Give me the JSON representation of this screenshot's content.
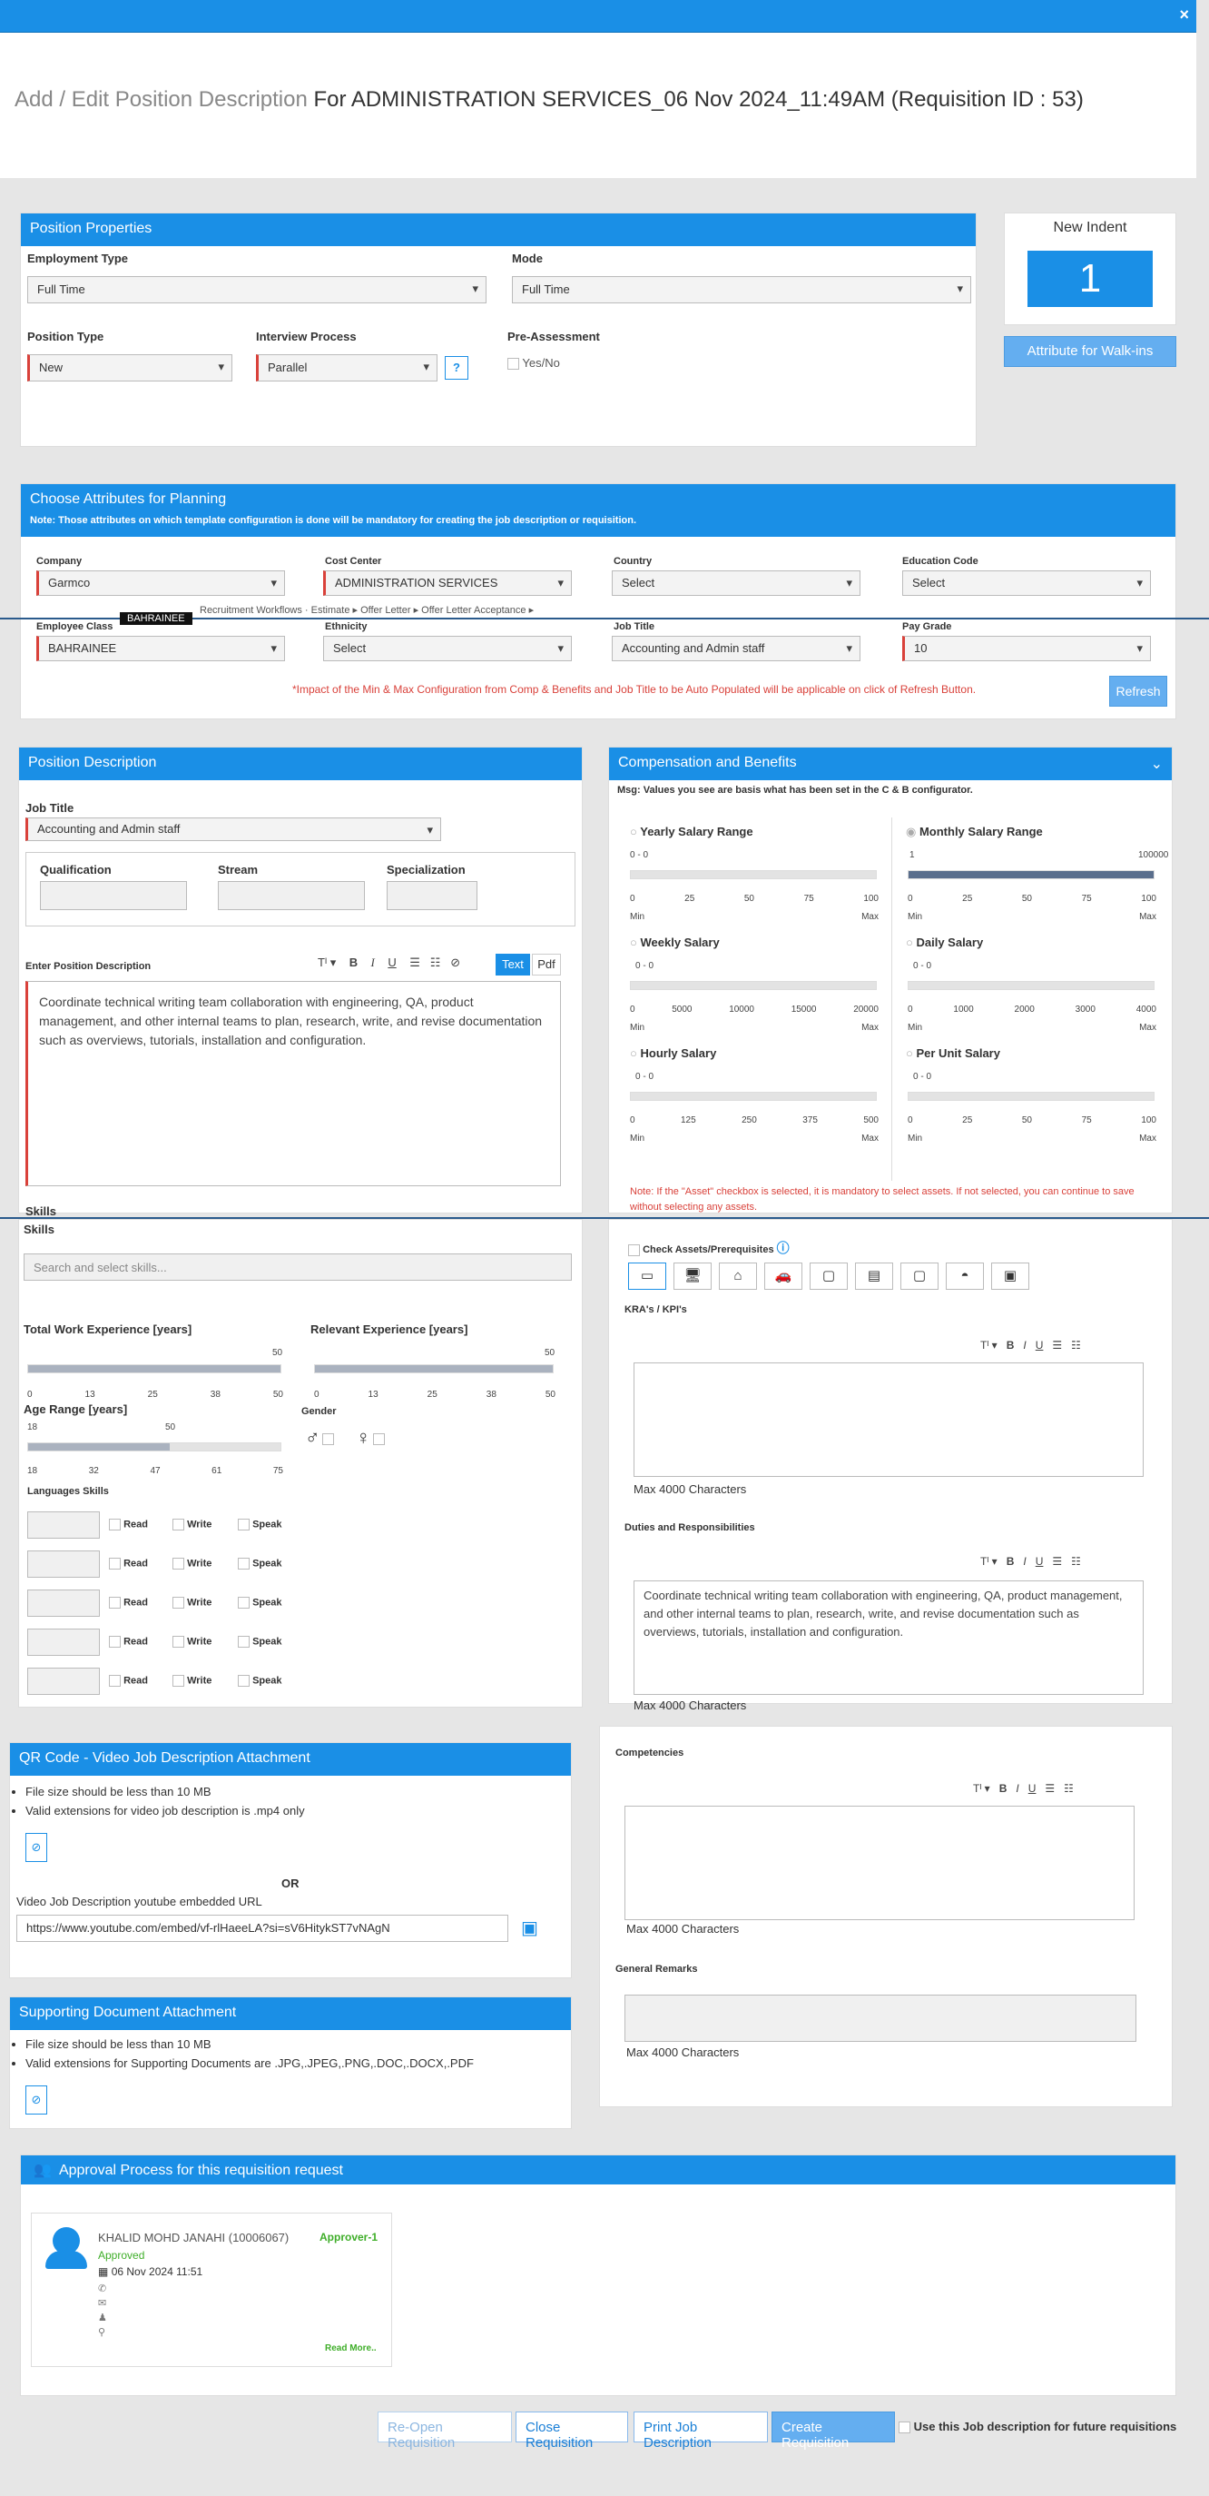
{
  "header": {
    "pre": "Add / Edit Position Description",
    "main": "For ADMINISTRATION SERVICES_06 Nov 2024_11:49AM  (Requisition ID : 53)",
    "close": "×"
  },
  "props": {
    "title": "Position Properties",
    "employment_type_label": "Employment Type",
    "employment_type": "Full Time",
    "mode_label": "Mode",
    "mode": "Full Time",
    "position_type_label": "Position Type",
    "position_type": "New",
    "interview_label": "Interview Process",
    "interview": "Parallel",
    "help": "?",
    "pre_assessment_label": "Pre-Assessment",
    "yes_no": "Yes/No"
  },
  "indent": {
    "title": "New Indent",
    "count": "1",
    "walkins": "Attribute for Walk-ins"
  },
  "attrs": {
    "title": "Choose Attributes for Planning",
    "note": "Note: Those attributes on which template configuration is done will be mandatory for creating the job description or requisition.",
    "company_label": "Company",
    "company": "Garmco",
    "cost_center_label": "Cost Center",
    "cost_center": "ADMINISTRATION SERVICES",
    "country_label": "Country",
    "country": "Select",
    "education_label": "Education Code",
    "education": "Select",
    "employee_class_label": "Employee Class",
    "employee_class": "BAHRAINEE",
    "tooltip": "BAHRAINEE",
    "ethnicity_label": "Ethnicity",
    "ethnicity": "Select",
    "job_title_label": "Job Title",
    "job_title": "Accounting and Admin staff",
    "pay_grade_label": "Pay Grade",
    "pay_grade": "10",
    "impact": "*Impact of the Min & Max Configuration from Comp & Benefits and Job Title to be Auto Populated will be applicable on click of Refresh Button.",
    "refresh": "Refresh",
    "hidden_row": "Recruitment Workflows   ·   Estimate ▸ Offer Letter ▸ Offer Letter Acceptance ▸"
  },
  "posdesc": {
    "title": "Position Description",
    "job_title_label": "Job Title",
    "job_title": "Accounting and Admin staff",
    "qualification": "Qualification",
    "stream": "Stream",
    "specialization": "Specialization",
    "enter_label": "Enter Position Description",
    "toolbar_text": "Text",
    "toolbar_pdf": "Pdf",
    "text": "Coordinate technical writing team collaboration with engineering, QA, product management, and other internal teams to plan, research, write, and revise documentation such as overviews, tutorials, installation and configuration."
  },
  "comp": {
    "title": "Compensation and Benefits",
    "msg": "Msg: Values you see are basis what has been set in the C & B configurator.",
    "yearly": "Yearly Salary Range",
    "monthly": "Monthly Salary Range",
    "weekly": "Weekly Salary",
    "daily": "Daily Salary",
    "hourly": "Hourly Salary",
    "per_unit": "Per Unit Salary",
    "range0": "0 - 0",
    "monthly_min": "1",
    "monthly_max": "100000",
    "min": "Min",
    "max": "Max",
    "yearly_ticks": [
      "0",
      "25",
      "50",
      "75",
      "100"
    ],
    "weekly_ticks": [
      "0",
      "5000",
      "10000",
      "15000",
      "20000"
    ],
    "daily_ticks": [
      "0",
      "1000",
      "2000",
      "3000",
      "4000"
    ],
    "hourly_ticks": [
      "0",
      "125",
      "250",
      "375",
      "500"
    ],
    "perunit_ticks": [
      "0",
      "25",
      "50",
      "75",
      "100"
    ],
    "note": "Note: If the \"Asset\" checkbox is selected, it is mandatory to select assets. If not selected, you can continue to save without selecting any assets."
  },
  "skills": {
    "label1": "Skills",
    "label2": "Skills",
    "placeholder": "Search and select skills...",
    "total_exp": "Total Work Experience   [years]",
    "relevant_exp": "Relevant Experience   [years]",
    "exp_max": "50",
    "exp_ticks": [
      "0",
      "13",
      "25",
      "38",
      "50"
    ],
    "age": "Age Range   [years]",
    "age_low": "18",
    "age_high": "50",
    "age_ticks": [
      "18",
      "32",
      "47",
      "61",
      "75"
    ],
    "gender": "Gender",
    "languages": "Languages Skills",
    "read": "Read",
    "write": "Write",
    "speak": "Speak"
  },
  "assets": {
    "check": "Check Assets/Prerequisites",
    "kra": "KRA's / KPI's",
    "max4000": "Max 4000 Characters",
    "duties": "Duties and Responsibilities",
    "duties_text": "Coordinate technical writing team collaboration with engineering, QA, product management, and other internal teams to plan, research, write, and revise documentation such as overviews, tutorials, installation and configuration.",
    "competencies": "Competencies",
    "remarks": "General Remarks"
  },
  "qr": {
    "title": "QR Code - Video Job Description Attachment",
    "b1": "File size should be less than 10 MB",
    "b2": "Valid extensions for video job description is .mp4 only",
    "or": "OR",
    "yt_label": "Video Job Description youtube embedded URL",
    "yt": "https://www.youtube.com/embed/vf-rlHaeeLA?si=sV6HitykST7vNAgN"
  },
  "support": {
    "title": "Supporting Document Attachment",
    "b1": "File size should be less than 10 MB",
    "b2": "Valid extensions for Supporting Documents are .JPG,.JPEG,.PNG,.DOC,.DOCX,.PDF"
  },
  "approval": {
    "title": "Approval Process for this requisition request",
    "name": "KHALID MOHD JANAHI (10006067)",
    "level": "Approver-1",
    "status": "Approved",
    "date": "06 Nov 2024 11:51",
    "readmore": "Read More.."
  },
  "footer": {
    "reopen": "Re-Open Requisition",
    "close": "Close Requisition",
    "print": "Print Job Description",
    "create": "Create Requisition",
    "future": "Use this Job description for future requisitions"
  }
}
